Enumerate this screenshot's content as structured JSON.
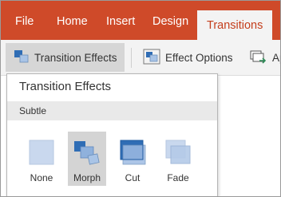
{
  "ribbon": {
    "tabs": [
      {
        "label": "File"
      },
      {
        "label": "Home"
      },
      {
        "label": "Insert"
      },
      {
        "label": "Design"
      },
      {
        "label": "Transitions",
        "active": true
      }
    ],
    "accent_color": "#cf4a29",
    "active_tab_text_color": "#c43e1c"
  },
  "commands": {
    "transition_effects": {
      "label": "Transition Effects",
      "icon": "transition-effects-icon",
      "pressed": true
    },
    "effect_options": {
      "label": "Effect Options",
      "icon": "effect-options-icon"
    },
    "apply_to_all": {
      "label": "Ap",
      "icon": "apply-to-all-icon"
    }
  },
  "panel": {
    "title": "Transition Effects",
    "section": "Subtle",
    "effects": [
      {
        "label": "None",
        "icon": "none-transition-icon"
      },
      {
        "label": "Morph",
        "icon": "morph-transition-icon",
        "selected": true
      },
      {
        "label": "Cut",
        "icon": "cut-transition-icon"
      },
      {
        "label": "Fade",
        "icon": "fade-transition-icon"
      }
    ]
  }
}
